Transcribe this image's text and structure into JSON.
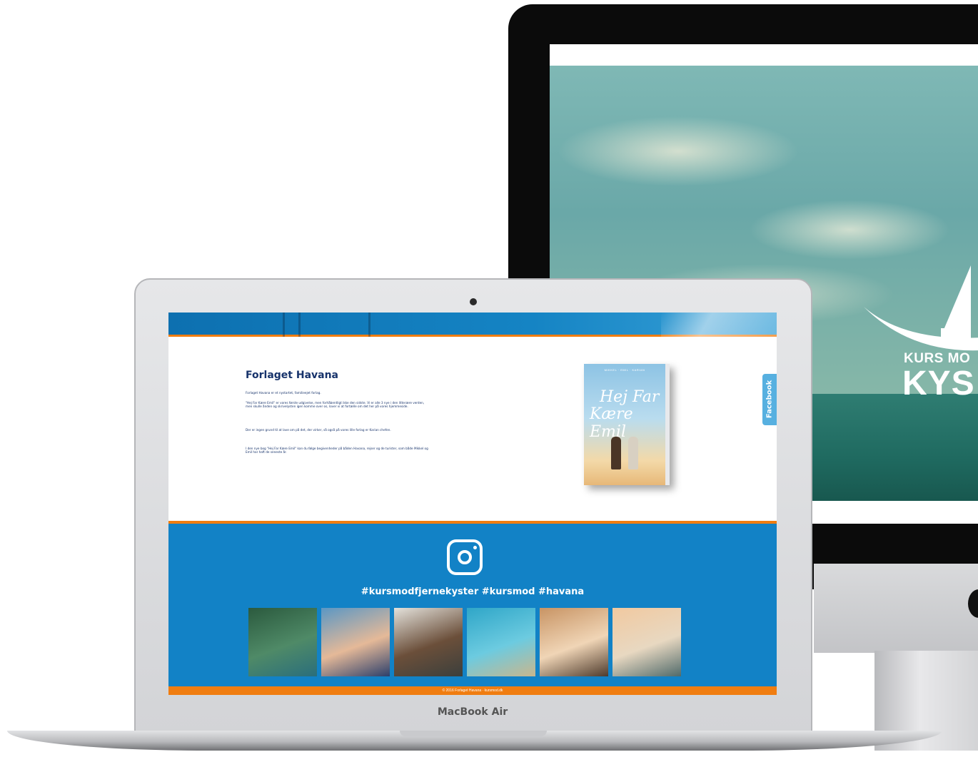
{
  "imac": {
    "logo_line1": "KURS MO",
    "logo_line2": "KYS"
  },
  "laptop": {
    "brand_label": "MacBook Air"
  },
  "site": {
    "about": {
      "title": "Forlaget Havana",
      "paragraphs": [
        "Forlaget Havana er et nystartet, familieejet forlag.",
        "\"Hej Far Kære Emil\" er vores første udgivelse, men forhåbentligt ikke den sidste. Vi er alle 3 nye i den litterære verden, men skulle ånden og skrivelysten igen komme over os, lover vi at fortælle om det her på vores hjemmeside.",
        "Der er ingen grund til at lave om på det, der virker, så også på vores lille forlag er Karian chefen.",
        "I den nye bog \"Hej Far Kære Emil\" kan du følge begivenheder på båden Havana, rejser og de turister, som både Mikkel og Emil har haft de seneste år."
      ]
    },
    "book": {
      "top_line": "MIKKEL · EMIL · KARIAN",
      "title_line1": "Hej Far",
      "title_line2": "Kære Emil"
    },
    "facebook_tab": "Facebook",
    "instagram": {
      "icon": "instagram-icon",
      "hashtags": "#kursmodfjernekyster #kursmod #havana",
      "photos": [
        {
          "name": "photo-lagoon",
          "colors": [
            "#2b5a3e",
            "#4f8a67",
            "#2a6e7c"
          ]
        },
        {
          "name": "photo-couple-smiling",
          "colors": [
            "#5b97c4",
            "#e5b998",
            "#2c3f6b"
          ]
        },
        {
          "name": "photo-boat-cockpit",
          "colors": [
            "#e4e2dc",
            "#6b4f3a",
            "#3b3f3c"
          ]
        },
        {
          "name": "photo-clear-water",
          "colors": [
            "#2fa6c8",
            "#6ccbe0",
            "#c9b68d"
          ]
        },
        {
          "name": "photo-couple-closeup",
          "colors": [
            "#c89464",
            "#f0d5b6",
            "#4d3a2c"
          ]
        },
        {
          "name": "photo-sunset-harbor",
          "colors": [
            "#f1c9a0",
            "#e8d8c1",
            "#506a6a"
          ]
        }
      ]
    },
    "footer_text": "© 2016 Forlaget Havana · kursmod.dk",
    "colors": {
      "brand_blue": "#1282c6",
      "accent_orange": "#f07d10",
      "title_navy": "#17336b"
    }
  }
}
